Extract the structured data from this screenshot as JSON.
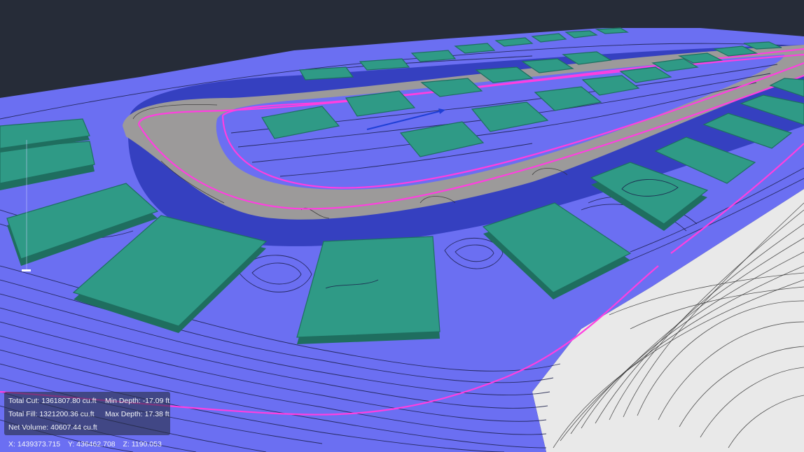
{
  "viewport": {
    "background": "#262c38",
    "colors": {
      "terrain_fill": "#6b6ff2",
      "terrain_deep": "#3540c0",
      "road": "#9c9a9a",
      "pads": "#2f9a86",
      "alignment": "#ff3fe0",
      "existing_ground": "#e8e8e8",
      "direction_arrow": "#1f3fd6"
    }
  },
  "stats": {
    "total_cut": "Total Cut: 1361807.80 cu.ft",
    "min_depth": "Min Depth: -17.09 ft",
    "total_fill": "Total Fill: 1321200.36 cu.ft",
    "max_depth": "Max Depth: 17.38 ft",
    "net_volume": "Net Volume: 40607.44 cu.ft"
  },
  "coordinates": {
    "x": "X: 1439373.715",
    "y": "Y: 436462.708",
    "z": "Z: 1190.053"
  }
}
